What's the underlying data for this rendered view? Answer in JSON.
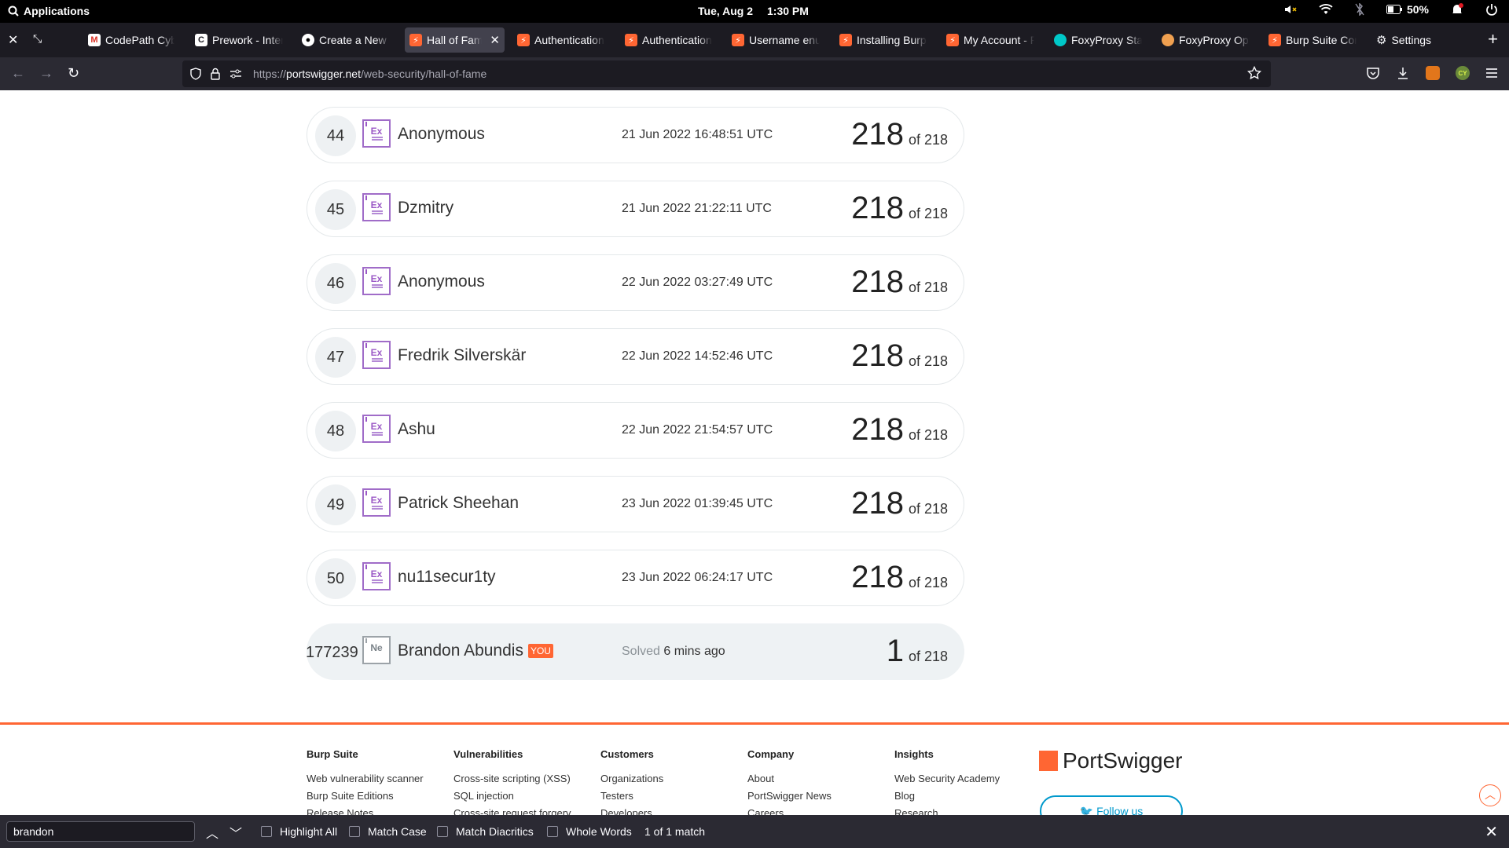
{
  "system_bar": {
    "apps_label": "Applications",
    "date": "Tue, Aug 2",
    "time": "1:30 PM",
    "battery": "50%"
  },
  "tabs": [
    {
      "label": "CodePath Cyb",
      "icon": "gmail-icon"
    },
    {
      "label": "Prework - Inter",
      "icon": "codepath-icon"
    },
    {
      "label": "Create a New R",
      "icon": "github-icon"
    },
    {
      "label": "Hall of Fame",
      "icon": "portswigger-icon",
      "active": true
    },
    {
      "label": "Authentication",
      "icon": "portswigger-icon"
    },
    {
      "label": "Authentication",
      "icon": "portswigger-icon"
    },
    {
      "label": "Username enu",
      "icon": "portswigger-icon"
    },
    {
      "label": "Installing Burp",
      "icon": "portswigger-icon"
    },
    {
      "label": "My Account - P",
      "icon": "portswigger-icon"
    },
    {
      "label": "FoxyProxy Star",
      "icon": "foxyproxy-icon"
    },
    {
      "label": "FoxyProxy Opt",
      "icon": "foxyproxy-options-icon"
    },
    {
      "label": "Burp Suite Con",
      "icon": "portswigger-icon"
    },
    {
      "label": "Settings",
      "icon": "gear-icon"
    }
  ],
  "address_bar": {
    "url_prefix": "https://",
    "url_domain": "portswigger.net",
    "url_path": "/web-security/hall-of-fame"
  },
  "leaderboard": [
    {
      "rank": "44",
      "badge": "Ex",
      "name": "Anonymous",
      "date": "21 Jun 2022 16:48:51 UTC",
      "score": "218",
      "of": "of 218"
    },
    {
      "rank": "45",
      "badge": "Ex",
      "name": "Dzmitry",
      "date": "21 Jun 2022 21:22:11 UTC",
      "score": "218",
      "of": "of 218"
    },
    {
      "rank": "46",
      "badge": "Ex",
      "name": "Anonymous",
      "date": "22 Jun 2022 03:27:49 UTC",
      "score": "218",
      "of": "of 218"
    },
    {
      "rank": "47",
      "badge": "Ex",
      "name": "Fredrik Silverskär",
      "date": "22 Jun 2022 14:52:46 UTC",
      "score": "218",
      "of": "of 218"
    },
    {
      "rank": "48",
      "badge": "Ex",
      "name": "Ashu",
      "date": "22 Jun 2022 21:54:57 UTC",
      "score": "218",
      "of": "of 218"
    },
    {
      "rank": "49",
      "badge": "Ex",
      "name": "Patrick Sheehan",
      "date": "23 Jun 2022 01:39:45 UTC",
      "score": "218",
      "of": "of 218"
    },
    {
      "rank": "50",
      "badge": "Ex",
      "name": "nu11secur1ty",
      "date": "23 Jun 2022 06:24:17 UTC",
      "score": "218",
      "of": "of 218"
    }
  ],
  "current_user": {
    "rank": "177239",
    "badge": "Ne",
    "name": "Brandon Abundis",
    "you_tag": "YOU",
    "solved_label": "Solved",
    "solved_time": "6 mins ago",
    "score": "1",
    "of": "of 218"
  },
  "footer": {
    "columns": [
      {
        "heading": "Burp Suite",
        "links": [
          "Web vulnerability scanner",
          "Burp Suite Editions",
          "Release Notes"
        ]
      },
      {
        "heading": "Vulnerabilities",
        "links": [
          "Cross-site scripting (XSS)",
          "SQL injection",
          "Cross-site request forgery"
        ]
      },
      {
        "heading": "Customers",
        "links": [
          "Organizations",
          "Testers",
          "Developers"
        ]
      },
      {
        "heading": "Company",
        "links": [
          "About",
          "PortSwigger News",
          "Careers"
        ]
      },
      {
        "heading": "Insights",
        "links": [
          "Web Security Academy",
          "Blog",
          "Research"
        ]
      }
    ],
    "logo_text": "PortSwigger",
    "follow_label": "Follow us"
  },
  "find_bar": {
    "query": "brandon",
    "options": [
      "Highlight All",
      "Match Case",
      "Match Diacritics",
      "Whole Words"
    ],
    "match_status": "1 of 1 match"
  },
  "colors": {
    "accent": "#ff6633",
    "expert_badge": "#9b59c6",
    "link_blue": "#0099cc"
  }
}
